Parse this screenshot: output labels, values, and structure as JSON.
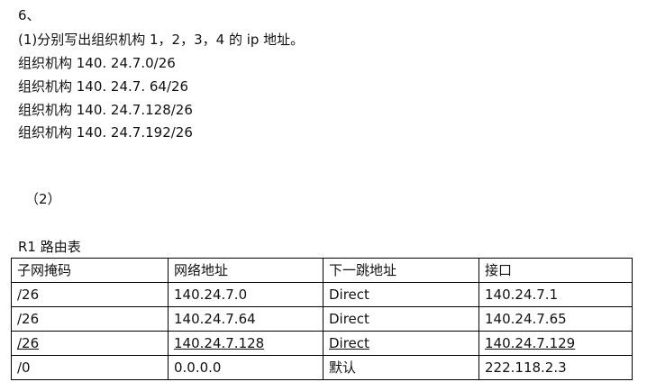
{
  "header": {
    "number": "6、",
    "question": "(1)分别写出组织机构 1，2，3，4 的 ip 地址。",
    "orgs": [
      "组织机构 140. 24.7.0/26",
      "组织机构 140. 24.7. 64/26",
      "组织机构 140. 24.7.128/26",
      "组织机构 140. 24.7.192/26"
    ],
    "part2": "（2）"
  },
  "table": {
    "title": "R1 路由表",
    "headers": [
      "子网掩码",
      "网络地址",
      "下一跳地址",
      "接口"
    ],
    "rows": [
      [
        "/26",
        "140.24.7.0",
        "Direct",
        "140.24.7.1"
      ],
      [
        "/26",
        "140.24.7.64",
        "Direct",
        "140.24.7.65"
      ],
      [
        "/26",
        "140.24.7.128",
        "Direct",
        "140.24.7.129"
      ],
      [
        "/0",
        "0.0.0.0",
        "默认",
        "222.118.2.3"
      ]
    ]
  }
}
